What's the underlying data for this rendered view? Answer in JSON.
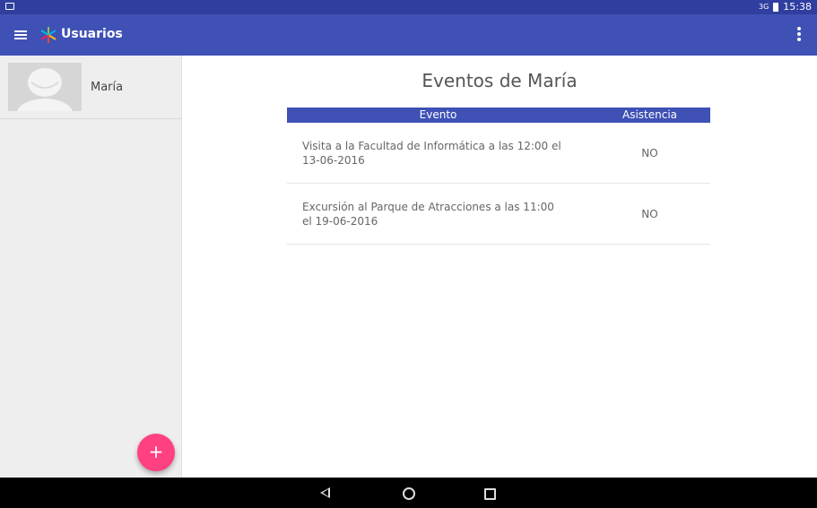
{
  "status_bar": {
    "time": "15:38",
    "network": "3G"
  },
  "app_bar": {
    "title": "Usuarios"
  },
  "sidebar": {
    "users": [
      {
        "name": "María"
      }
    ],
    "fab_label": "+"
  },
  "main": {
    "title": "Eventos de María",
    "table": {
      "headers": [
        "Evento",
        "Asistencia"
      ],
      "rows": [
        {
          "evento": "Visita a la Facultad de Informática a las 12:00 el 13-06-2016",
          "asistencia": "NO"
        },
        {
          "evento": "Excursión al Parque de Atracciones a las 11:00 el 19-06-2016",
          "asistencia": "NO"
        }
      ]
    }
  },
  "colors": {
    "primary": "#3F51B5",
    "primary_dark": "#303F9F",
    "accent": "#FF4081"
  },
  "icons": [
    "menu-icon",
    "app-logo-icon",
    "overflow-menu-icon",
    "back-icon",
    "home-icon",
    "recents-icon",
    "add-icon"
  ]
}
